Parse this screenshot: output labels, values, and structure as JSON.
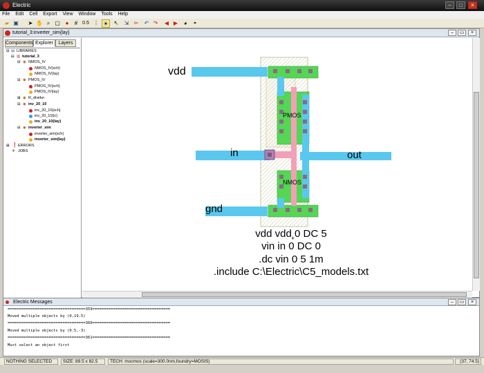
{
  "window": {
    "title": "Electric"
  },
  "menu": [
    "File",
    "Edit",
    "Cell",
    "Export",
    "View",
    "Window",
    "Tools",
    "Help"
  ],
  "toolbar": {
    "scale_label": "0.5"
  },
  "document": {
    "title": "tutorial_3:inverter_sim{lay}"
  },
  "panel": {
    "tabs": [
      "Components",
      "Explorer",
      "Layers"
    ],
    "tree": [
      {
        "label": "LIBRARIES"
      },
      {
        "label": "tutorial_3"
      },
      {
        "label": "NMOS_IV"
      },
      {
        "label": "NMOS_IV{sch}"
      },
      {
        "label": "NMOS_IV{lay}"
      },
      {
        "label": "PMOS_IV"
      },
      {
        "label": "PMOS_IV{sch}"
      },
      {
        "label": "PMOS_IV{lay}"
      },
      {
        "label": "R_divider"
      },
      {
        "label": "inv_20_10"
      },
      {
        "label": "inv_20_10{sch}"
      },
      {
        "label": "inv_20_10{ic}"
      },
      {
        "label": "inv_20_10{lay}"
      },
      {
        "label": "inverter_sim"
      },
      {
        "label": "inverter_sim{sch}"
      },
      {
        "label": "inverter_sim{lay}"
      },
      {
        "label": "ERRORS"
      },
      {
        "label": "JOBS"
      }
    ]
  },
  "layout": {
    "labels": {
      "vdd": "vdd",
      "in": "in",
      "out": "out",
      "gnd": "gnd",
      "pmos": "PMOS",
      "nmos": "NMOS"
    },
    "spice": [
      "vdd vdd 0 DC 5",
      "vin in 0 DC 0",
      ".dc vin 0 5 1m",
      ".include C:\\Electric\\C5_models.txt"
    ]
  },
  "messages": {
    "title": "Electric Messages",
    "lines": [
      "==================================359==================================",
      "Moved multiple objects by (0,19.5)",
      "==================================360==================================",
      "Moved multiple objects by (0.5,-3)",
      "==================================361==================================",
      "Must select an object first"
    ]
  },
  "status": {
    "selection": "NOTHING SELECTED",
    "size": "SIZE: 89.5 x 82.5",
    "tech": "TECH: mocmos (scale=300.0nm,foundry=MOSIS)",
    "coords": "(37, 74.5)"
  },
  "colors": {
    "metal1": "#5ac8ee",
    "active": "#55d655",
    "poly": "#f2a0b8",
    "select": "#dede66"
  }
}
